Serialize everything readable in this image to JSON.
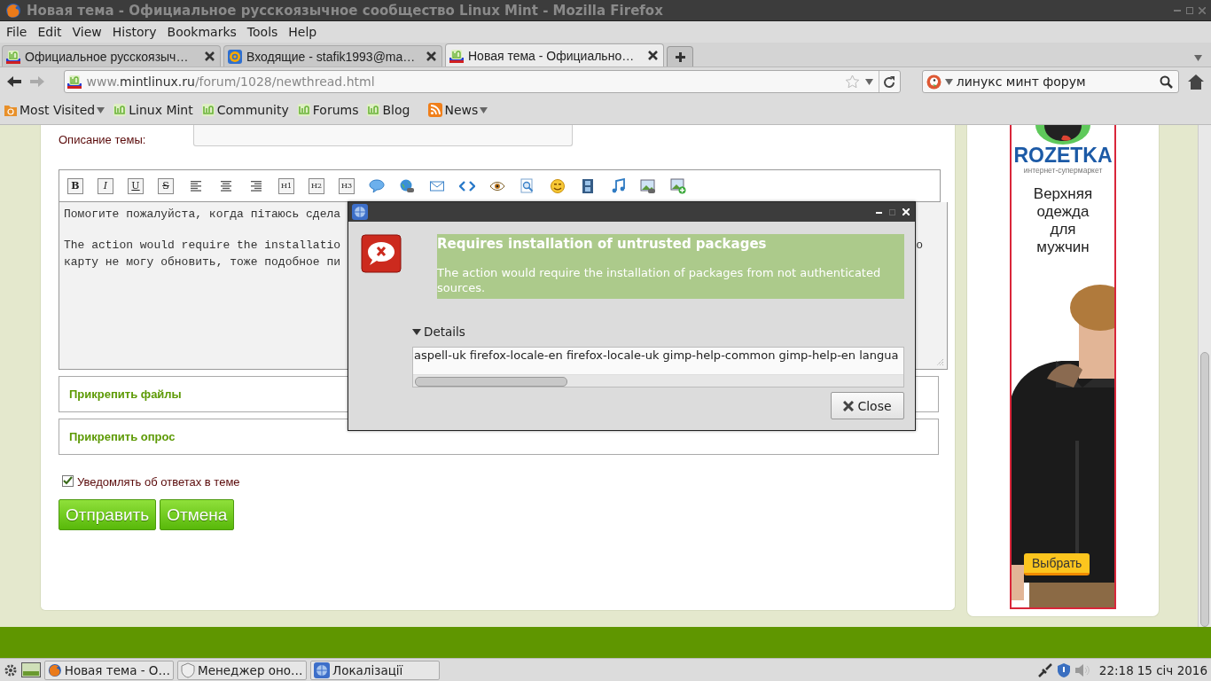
{
  "window": {
    "title": "Новая тема - Официальное русскоязычное сообщество Linux Mint - Mozilla Firefox"
  },
  "menu": [
    "File",
    "Edit",
    "View",
    "History",
    "Bookmarks",
    "Tools",
    "Help"
  ],
  "tabs": [
    {
      "label": "Официальное русскоязыч…",
      "kind": "site",
      "selected": false
    },
    {
      "label": "Входящие - stafik1993@ma…",
      "kind": "mail",
      "selected": false
    },
    {
      "label": "Новая тема - Официально…",
      "kind": "site",
      "selected": true
    }
  ],
  "navigation": {
    "url": {
      "prefix": "www.",
      "host": "mintlinux.ru",
      "path": "/forum/1028/newthread.html"
    },
    "search": {
      "value": "линукс минт форум"
    }
  },
  "bookmarks": [
    {
      "label": "Most Visited",
      "kind": "folder",
      "dropdown": true
    },
    {
      "label": "Linux Mint",
      "kind": "site",
      "dropdown": false
    },
    {
      "label": "Community",
      "kind": "site",
      "dropdown": false
    },
    {
      "label": "Forums",
      "kind": "site",
      "dropdown": false
    },
    {
      "label": "Blog",
      "kind": "site",
      "dropdown": false
    },
    {
      "label": "News",
      "kind": "feed",
      "dropdown": true
    }
  ],
  "form": {
    "description_label": "Описание темы:",
    "editor_toolbar": [
      {
        "kind": "bold",
        "label": "B"
      },
      {
        "kind": "italic",
        "label": "I"
      },
      {
        "kind": "underline",
        "label": "U"
      },
      {
        "kind": "strike",
        "label": "S"
      },
      {
        "kind": "align-left"
      },
      {
        "kind": "align-center"
      },
      {
        "kind": "align-right"
      },
      {
        "kind": "heading",
        "label": "H1"
      },
      {
        "kind": "heading",
        "label": "H2"
      },
      {
        "kind": "heading",
        "label": "H3"
      },
      {
        "kind": "speech-bubble"
      },
      {
        "kind": "globe-link"
      },
      {
        "kind": "envelope"
      },
      {
        "kind": "code"
      },
      {
        "kind": "eye"
      },
      {
        "kind": "magnifier"
      },
      {
        "kind": "smiley"
      },
      {
        "kind": "film"
      },
      {
        "kind": "music"
      },
      {
        "kind": "image-link"
      },
      {
        "kind": "image-add"
      }
    ],
    "editor_paragraphs": [
      [
        "Помогите пожалуйста, когда пітаюсь сдела"
      ],
      [
        "The action would require the installatio",
        "карту не могу обновить, тоже подобное пи"
      ]
    ],
    "editor_fragment": "о",
    "sections": [
      "Прикрепить файлы",
      "Прикрепить опрос"
    ],
    "notify": {
      "label": "Уведомлять об ответах в теме",
      "checked": true
    },
    "buttons": [
      "Отправить",
      "Отмена"
    ]
  },
  "ad": {
    "brand": "ROZETKA",
    "tagline": "интернет-супермаркет",
    "headline": "Верхняя одежда для мужчин",
    "button": "Выбрать"
  },
  "dialog": {
    "heading": "Requires installation of untrusted packages",
    "message": "The action would require the installation of packages from not authenticated sources.",
    "details_label": "Details",
    "expanded": true,
    "details_text": "aspell-uk firefox-locale-en firefox-locale-uk gimp-help-common gimp-help-en langua",
    "close": "Close"
  },
  "taskbar": {
    "items": [
      {
        "label": "Новая тема - О…",
        "kind": "browser",
        "selected": false
      },
      {
        "label": "Менеджер оно…",
        "kind": "updater",
        "selected": false
      },
      {
        "label": "Локалізації",
        "kind": "settings",
        "selected": false
      }
    ],
    "clock": "22:18",
    "date": "15 січ 2016"
  }
}
